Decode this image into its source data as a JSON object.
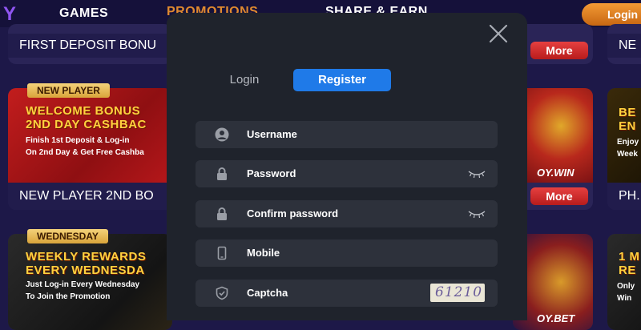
{
  "nav": {
    "logo_fragment": "Y",
    "games": "GAMES",
    "promotions": "PROMOTIONS",
    "share_earn": "SHARE & EARN",
    "login": "Login"
  },
  "cards": {
    "first_deposit": {
      "caption": "FIRST DEPOSIT BONU"
    },
    "new_player": {
      "ribbon": "NEW PLAYER",
      "head_line1": "WELCOME BONUS",
      "head_line2": "2ND DAY CASHBAC",
      "sub_line1": "Finish 1st Deposit & Log-in",
      "sub_line2": "On 2nd Day & Get Free Cashba",
      "caption": "NEW PLAYER 2ND BO"
    },
    "wednesday": {
      "ribbon": "WEDNESDAY",
      "head_line1": "WEEKLY REWARDS",
      "head_line2": "EVERY WEDNESDA",
      "sub_line1": "Just Log-in Every Wednesday",
      "sub_line2": "To Join the Promotion"
    },
    "right_top": {
      "more": "More",
      "caption_fragment": "NE"
    },
    "right_mid": {
      "brand": "OY.WIN",
      "more": "More",
      "caption_fragment": "PH.",
      "head1": "BE",
      "head2": "EN",
      "sub1": "Enjoy",
      "sub2": "Week"
    },
    "right_bottom": {
      "brand": "OY.BET",
      "head1": "1 M",
      "head2": "RE",
      "sub1": "Only",
      "sub2": "Win"
    }
  },
  "modal": {
    "tabs": [
      {
        "label": "Login",
        "active": false
      },
      {
        "label": "Register",
        "active": true
      }
    ],
    "fields": {
      "username": {
        "label": "Username",
        "icon": "user-icon"
      },
      "password": {
        "label": "Password",
        "icon": "lock-icon"
      },
      "confirm_password": {
        "label": "Confirm password",
        "icon": "lock-icon"
      },
      "mobile": {
        "label": "Mobile",
        "icon": "phone-icon"
      },
      "captcha": {
        "label": "Captcha",
        "icon": "shield-icon",
        "code": "61210"
      }
    }
  },
  "colors": {
    "page_bg": "#1d1848",
    "modal_bg": "#1f232c",
    "field_bg": "#2d313b",
    "accent_blue": "#1f7ae8",
    "promo_orange": "#e08a2f",
    "more_red": "#d22a2a"
  }
}
